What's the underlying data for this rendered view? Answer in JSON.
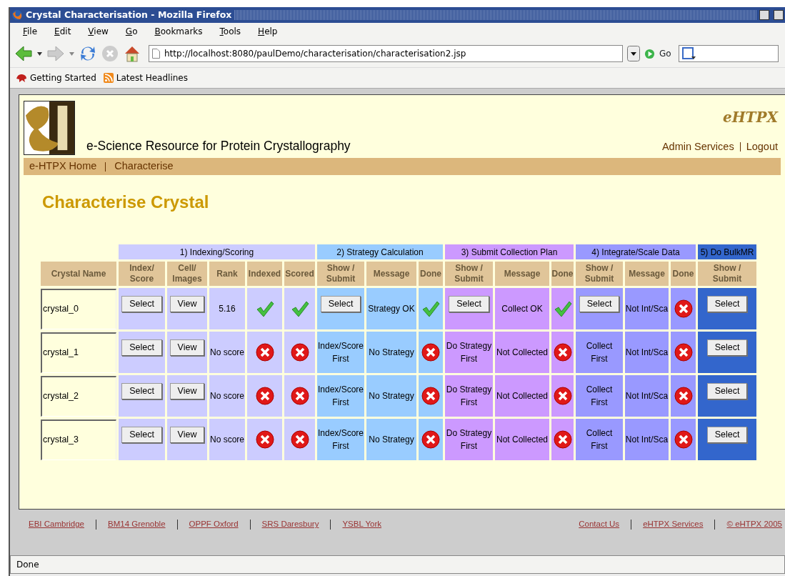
{
  "window": {
    "title": "Crystal Characterisation - Mozilla Firefox"
  },
  "menu": [
    "File",
    "Edit",
    "View",
    "Go",
    "Bookmarks",
    "Tools",
    "Help"
  ],
  "toolbar": {
    "url": "http://localhost:8080/paulDemo/characterisation/characterisation2.jsp",
    "go": "Go"
  },
  "bookmarks": [
    "Getting Started",
    "Latest Headlines"
  ],
  "page": {
    "site_title": "e-Science Resource for Protein Crystallography",
    "brand": "eHTPX",
    "account_links": [
      "Admin Services",
      "Logout"
    ],
    "breadcrumbs": [
      "e-HTPX Home",
      "Characterise"
    ],
    "heading": "Characterise Crystal",
    "table": {
      "name_column": "Crystal Name",
      "groups": [
        {
          "title": "1) Indexing/Scoring",
          "color": "#ccccff",
          "columns": [
            "Index/\nScore",
            "Cell/\nImages",
            "Rank",
            "Indexed",
            "Scored"
          ]
        },
        {
          "title": "2) Strategy Calculation",
          "color": "#99ccff",
          "columns": [
            "Show /\nSubmit",
            "Message",
            "Done"
          ]
        },
        {
          "title": "3) Submit Collection Plan",
          "color": "#cc99ff",
          "columns": [
            "Show /\nSubmit",
            "Message",
            "Done"
          ]
        },
        {
          "title": "4) Integrate/Scale Data",
          "color": "#9999ff",
          "columns": [
            "Show /\nSubmit",
            "Message",
            "Done"
          ]
        },
        {
          "title": "5) Do BulkMR",
          "color": "#3366cc",
          "columns": [
            "Show /\nSubmit"
          ]
        }
      ],
      "rows": [
        {
          "name": "crystal_0",
          "cells": [
            {
              "kind": "button",
              "text": "Select"
            },
            {
              "kind": "button",
              "text": "View"
            },
            {
              "kind": "text",
              "text": "5.16"
            },
            {
              "kind": "status",
              "done": true
            },
            {
              "kind": "status",
              "done": true
            },
            {
              "kind": "button",
              "text": "Select"
            },
            {
              "kind": "text",
              "text": "Strategy OK"
            },
            {
              "kind": "status",
              "done": true
            },
            {
              "kind": "button",
              "text": "Select"
            },
            {
              "kind": "text",
              "text": "Collect OK"
            },
            {
              "kind": "status",
              "done": true
            },
            {
              "kind": "button",
              "text": "Select"
            },
            {
              "kind": "text",
              "text": "Not Int/Sca"
            },
            {
              "kind": "status",
              "done": false
            },
            {
              "kind": "button",
              "text": "Select"
            }
          ]
        },
        {
          "name": "crystal_1",
          "cells": [
            {
              "kind": "button",
              "text": "Select"
            },
            {
              "kind": "button",
              "text": "View"
            },
            {
              "kind": "text",
              "text": "No score"
            },
            {
              "kind": "status",
              "done": false
            },
            {
              "kind": "status",
              "done": false
            },
            {
              "kind": "text",
              "text": "Index/Score\nFirst"
            },
            {
              "kind": "text",
              "text": "No Strategy"
            },
            {
              "kind": "status",
              "done": false
            },
            {
              "kind": "text",
              "text": "Do Strategy\nFirst"
            },
            {
              "kind": "text",
              "text": "Not Collected"
            },
            {
              "kind": "status",
              "done": false
            },
            {
              "kind": "text",
              "text": "Collect\nFirst"
            },
            {
              "kind": "text",
              "text": "Not Int/Sca"
            },
            {
              "kind": "status",
              "done": false
            },
            {
              "kind": "button",
              "text": "Select"
            }
          ]
        },
        {
          "name": "crystal_2",
          "cells": [
            {
              "kind": "button",
              "text": "Select"
            },
            {
              "kind": "button",
              "text": "View"
            },
            {
              "kind": "text",
              "text": "No score"
            },
            {
              "kind": "status",
              "done": false
            },
            {
              "kind": "status",
              "done": false
            },
            {
              "kind": "text",
              "text": "Index/Score\nFirst"
            },
            {
              "kind": "text",
              "text": "No Strategy"
            },
            {
              "kind": "status",
              "done": false
            },
            {
              "kind": "text",
              "text": "Do Strategy\nFirst"
            },
            {
              "kind": "text",
              "text": "Not Collected"
            },
            {
              "kind": "status",
              "done": false
            },
            {
              "kind": "text",
              "text": "Collect\nFirst"
            },
            {
              "kind": "text",
              "text": "Not Int/Sca"
            },
            {
              "kind": "status",
              "done": false
            },
            {
              "kind": "button",
              "text": "Select"
            }
          ]
        },
        {
          "name": "crystal_3",
          "cells": [
            {
              "kind": "button",
              "text": "Select"
            },
            {
              "kind": "button",
              "text": "View"
            },
            {
              "kind": "text",
              "text": "No score"
            },
            {
              "kind": "status",
              "done": false
            },
            {
              "kind": "status",
              "done": false
            },
            {
              "kind": "text",
              "text": "Index/Score\nFirst"
            },
            {
              "kind": "text",
              "text": "No Strategy"
            },
            {
              "kind": "status",
              "done": false
            },
            {
              "kind": "text",
              "text": "Do Strategy\nFirst"
            },
            {
              "kind": "text",
              "text": "Not Collected"
            },
            {
              "kind": "status",
              "done": false
            },
            {
              "kind": "text",
              "text": "Collect\nFirst"
            },
            {
              "kind": "text",
              "text": "Not Int/Sca"
            },
            {
              "kind": "status",
              "done": false
            },
            {
              "kind": "button",
              "text": "Select"
            }
          ]
        }
      ]
    },
    "footer_left": [
      "EBI Cambridge",
      "BM14 Grenoble",
      "OPPF Oxford",
      "SRS Daresbury",
      "YSBL York"
    ],
    "footer_right": [
      "Contact Us",
      "eHTPX Services",
      "© eHTPX 2005"
    ]
  },
  "status_bar": "Done"
}
